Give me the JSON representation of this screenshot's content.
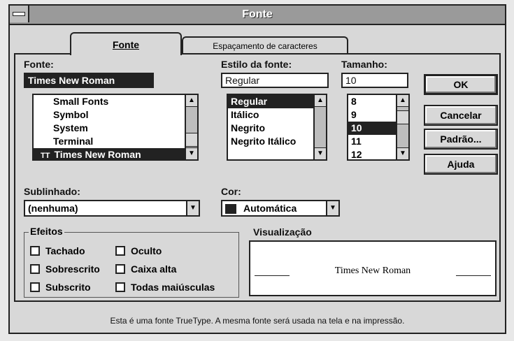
{
  "window": {
    "title": "Fonte"
  },
  "tabs": [
    {
      "label": "Fonte",
      "active": true
    },
    {
      "label": "Espaçamento de caracteres",
      "active": false
    }
  ],
  "font": {
    "label": "Fonte:",
    "value": "Times New Roman",
    "items": [
      "Small Fonts",
      "Symbol",
      "System",
      "Terminal",
      "Times New Roman"
    ],
    "selected_index": 4,
    "item_icon": "truetype-icon"
  },
  "style": {
    "label": "Estilo da fonte:",
    "value": "Regular",
    "items": [
      "Regular",
      "Itálico",
      "Negrito",
      "Negrito Itálico"
    ],
    "selected_index": 0
  },
  "size": {
    "label": "Tamanho:",
    "value": "10",
    "items": [
      "8",
      "9",
      "10",
      "11",
      "12"
    ],
    "selected_index": 2
  },
  "buttons": {
    "ok": "OK",
    "cancel": "Cancelar",
    "default": "Padrão...",
    "help": "Ajuda"
  },
  "underline": {
    "label": "Sublinhado:",
    "value": "(nenhuma)"
  },
  "color": {
    "label": "Cor:",
    "value": "Automática",
    "swatch": "#222222"
  },
  "effects": {
    "label": "Efeitos",
    "items": [
      "Tachado",
      "Sobrescrito",
      "Subscrito",
      "Oculto",
      "Caixa alta",
      "Todas maiúsculas"
    ]
  },
  "preview": {
    "label": "Visualização",
    "text": "Times New Roman"
  },
  "status": "Esta é uma fonte TrueType. A mesma fonte será usada na tela e na impressão."
}
